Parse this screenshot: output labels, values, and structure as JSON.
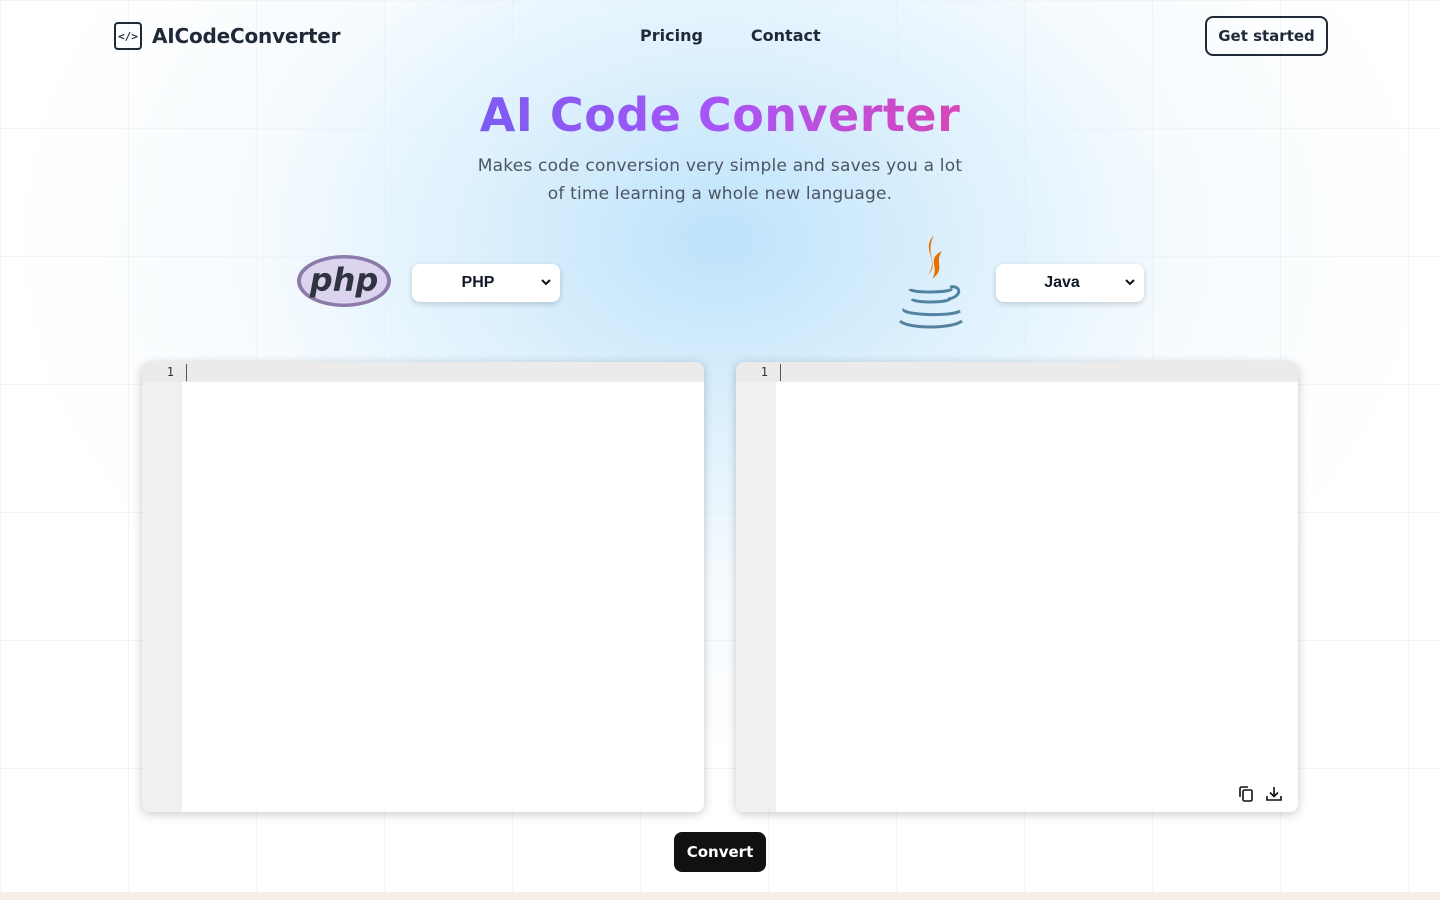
{
  "header": {
    "brand_icon_glyph": "</>",
    "brand_name": "AICodeConverter",
    "nav": [
      {
        "label": "Pricing"
      },
      {
        "label": "Contact"
      }
    ],
    "cta_label": "Get started"
  },
  "hero": {
    "title": "AI Code Converter",
    "subtitle": "Makes code conversion very simple and saves you a lot of time learning a whole new language."
  },
  "source": {
    "logo_text": "php",
    "logo_icon": "php-logo-icon",
    "language": "PHP",
    "line_number": "1"
  },
  "target": {
    "logo_icon": "java-logo-icon",
    "language": "Java",
    "line_number": "1"
  },
  "output_tools": [
    {
      "icon": "copy-icon"
    },
    {
      "icon": "download-icon"
    }
  ],
  "convert_label": "Convert",
  "colors": {
    "title_gradient_start": "#7c5cf2",
    "title_gradient_end": "#d946b8",
    "button_dark": "#111111",
    "php_purple": "#8892bf",
    "java_orange": "#e76f00",
    "java_blue": "#5382a1"
  }
}
